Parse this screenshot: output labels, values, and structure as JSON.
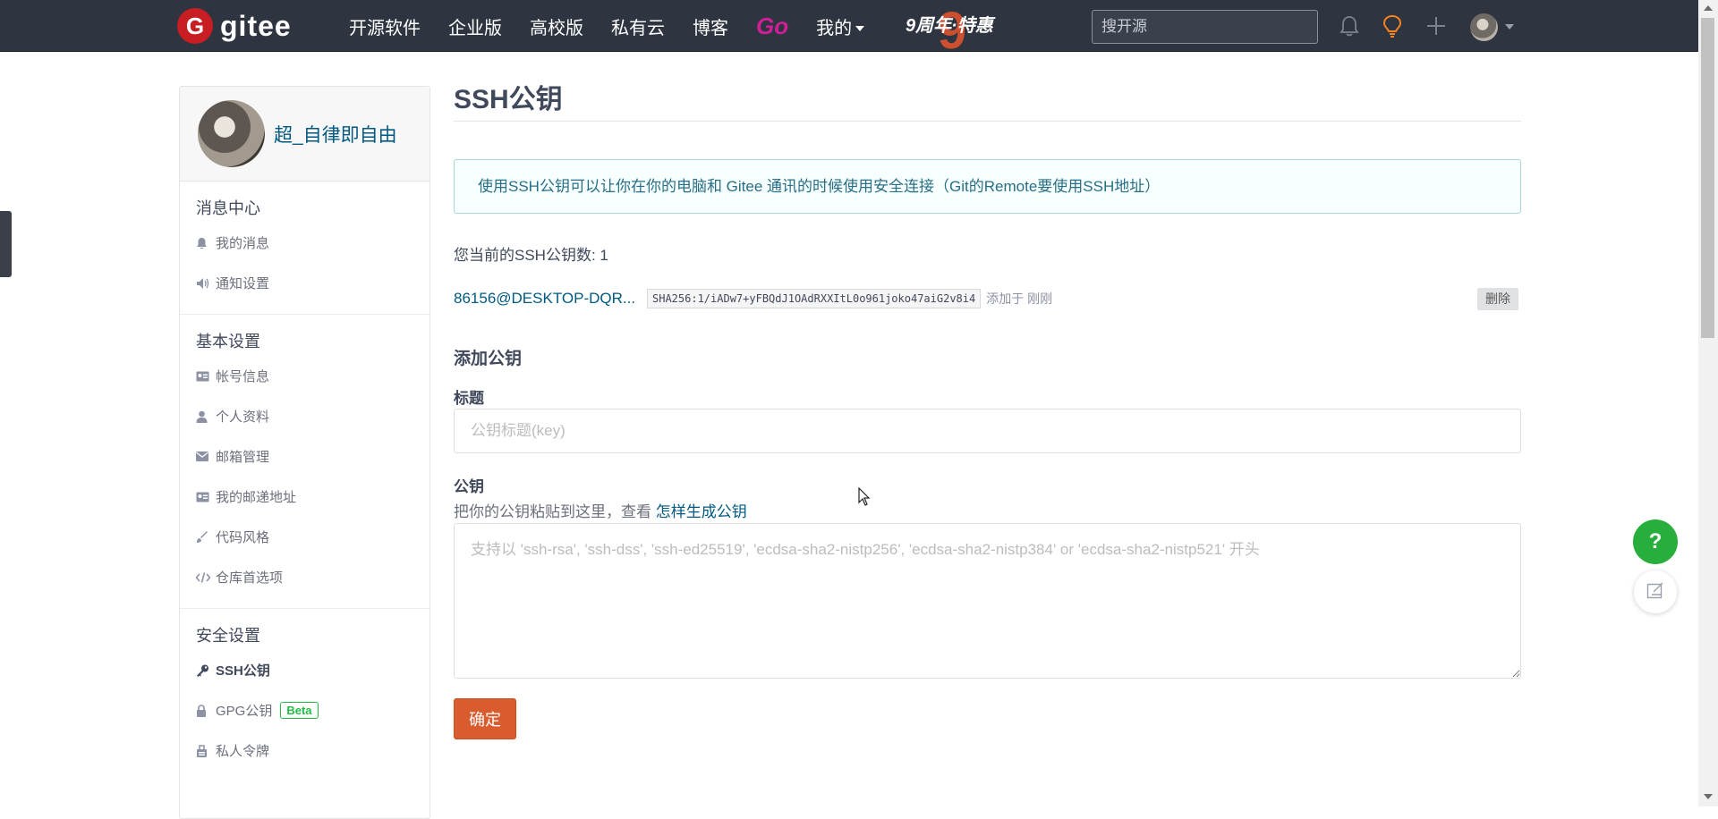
{
  "colors": {
    "navbar": "#2e3440",
    "brand_red": "#c71d23",
    "go_pink": "#d01e97",
    "primary_orange": "#da5b2d",
    "link_blue": "#005980",
    "help_green": "#27ae3c"
  },
  "navbar": {
    "logo_glyph": "G",
    "logo_text": "gitee",
    "links": [
      "开源软件",
      "企业版",
      "高校版",
      "私有云",
      "博客"
    ],
    "go_label": "Go",
    "mine_label": "我的",
    "promo_label": "9周年·特惠",
    "promo_digit": "9",
    "search_placeholder": "搜开源",
    "icons": [
      "bell-icon",
      "lightbulb-icon",
      "plus-icon"
    ]
  },
  "sidebar": {
    "user_name": "超_自律即自由",
    "sections": [
      {
        "title": "消息中心",
        "items": [
          {
            "label": "我的消息",
            "icon": "bell-icon"
          },
          {
            "label": "通知设置",
            "icon": "volume-icon"
          }
        ]
      },
      {
        "title": "基本设置",
        "items": [
          {
            "label": "帐号信息",
            "icon": "id-card-icon"
          },
          {
            "label": "个人资料",
            "icon": "user-icon"
          },
          {
            "label": "邮箱管理",
            "icon": "mail-icon"
          },
          {
            "label": "我的邮递地址",
            "icon": "address-card-icon"
          },
          {
            "label": "代码风格",
            "icon": "brush-icon"
          },
          {
            "label": "仓库首选项",
            "icon": "code-icon"
          }
        ]
      },
      {
        "title": "安全设置",
        "items": [
          {
            "label": "SSH公钥",
            "icon": "key-icon",
            "active": true
          },
          {
            "label": "GPG公钥",
            "icon": "lock-icon",
            "badge": "Beta"
          },
          {
            "label": "私人令牌",
            "icon": "token-icon"
          }
        ]
      }
    ]
  },
  "main": {
    "title": "SSH公钥",
    "info": "使用SSH公钥可以让你在你的电脑和 Gitee 通讯的时候使用安全连接（Git的Remote要使用SSH地址）",
    "key_count": "您当前的SSH公钥数: 1",
    "keys": [
      {
        "title": "86156@DESKTOP-DQR...",
        "fingerprint": "SHA256:1/iADw7+yFBQdJ1OAdRXXItL0o961joko47aiG2v8i4",
        "added": "添加于 刚刚",
        "delete_label": "删除"
      }
    ],
    "add_title": "添加公钥",
    "label_title": "标题",
    "title_placeholder": "公钥标题(key)",
    "label_key": "公钥",
    "key_hint_prefix": "把你的公钥粘贴到这里，查看 ",
    "key_hint_link": "怎样生成公钥",
    "key_placeholder": "支持以 'ssh-rsa', 'ssh-dss', 'ssh-ed25519', 'ecdsa-sha2-nistp256', 'ecdsa-sha2-nistp384' or 'ecdsa-sha2-nistp521' 开头",
    "submit_label": "确定"
  },
  "floating": {
    "help_label": "?",
    "feedback_icon": "edit-icon"
  }
}
